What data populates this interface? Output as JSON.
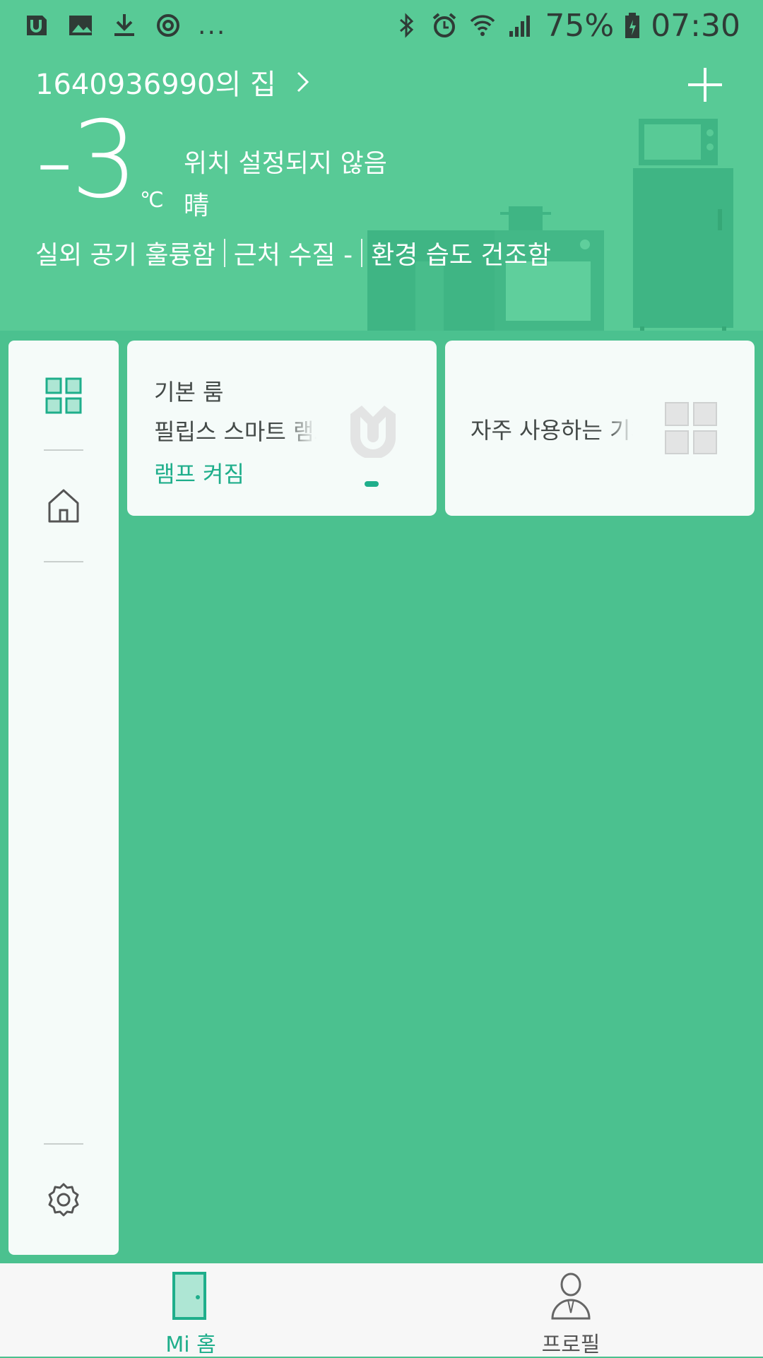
{
  "status_bar": {
    "left_icons": [
      "app-notification-icon",
      "image-icon",
      "download-icon",
      "sync-icon"
    ],
    "more": "...",
    "right_icons": [
      "bluetooth-icon",
      "alarm-icon",
      "wifi-icon",
      "signal-icon",
      "battery-icon"
    ],
    "battery": "75%",
    "time": "07:30"
  },
  "header": {
    "home_title": "1640936990의 집",
    "temperature": "-3",
    "temperature_unit": "℃",
    "location": "위치 설정되지 않음",
    "condition": "晴",
    "env": [
      "실외 공기 훌륭함",
      "근처 수질 -",
      "환경 습도 건조함"
    ]
  },
  "sidebar": {
    "items": [
      "grid-icon",
      "home-icon",
      "settings-icon"
    ]
  },
  "cards": {
    "room": "기본 룸",
    "device": "필립스 스마트 램프",
    "status": "램프 켜짐",
    "favorites": "자주 사용하는 기기"
  },
  "bottom_nav": {
    "home": "Mi 홈",
    "profile": "프로필"
  },
  "colors": {
    "header_bg": "#58ca96",
    "body_bg": "#4bc18f",
    "accent": "#1fae8b"
  }
}
